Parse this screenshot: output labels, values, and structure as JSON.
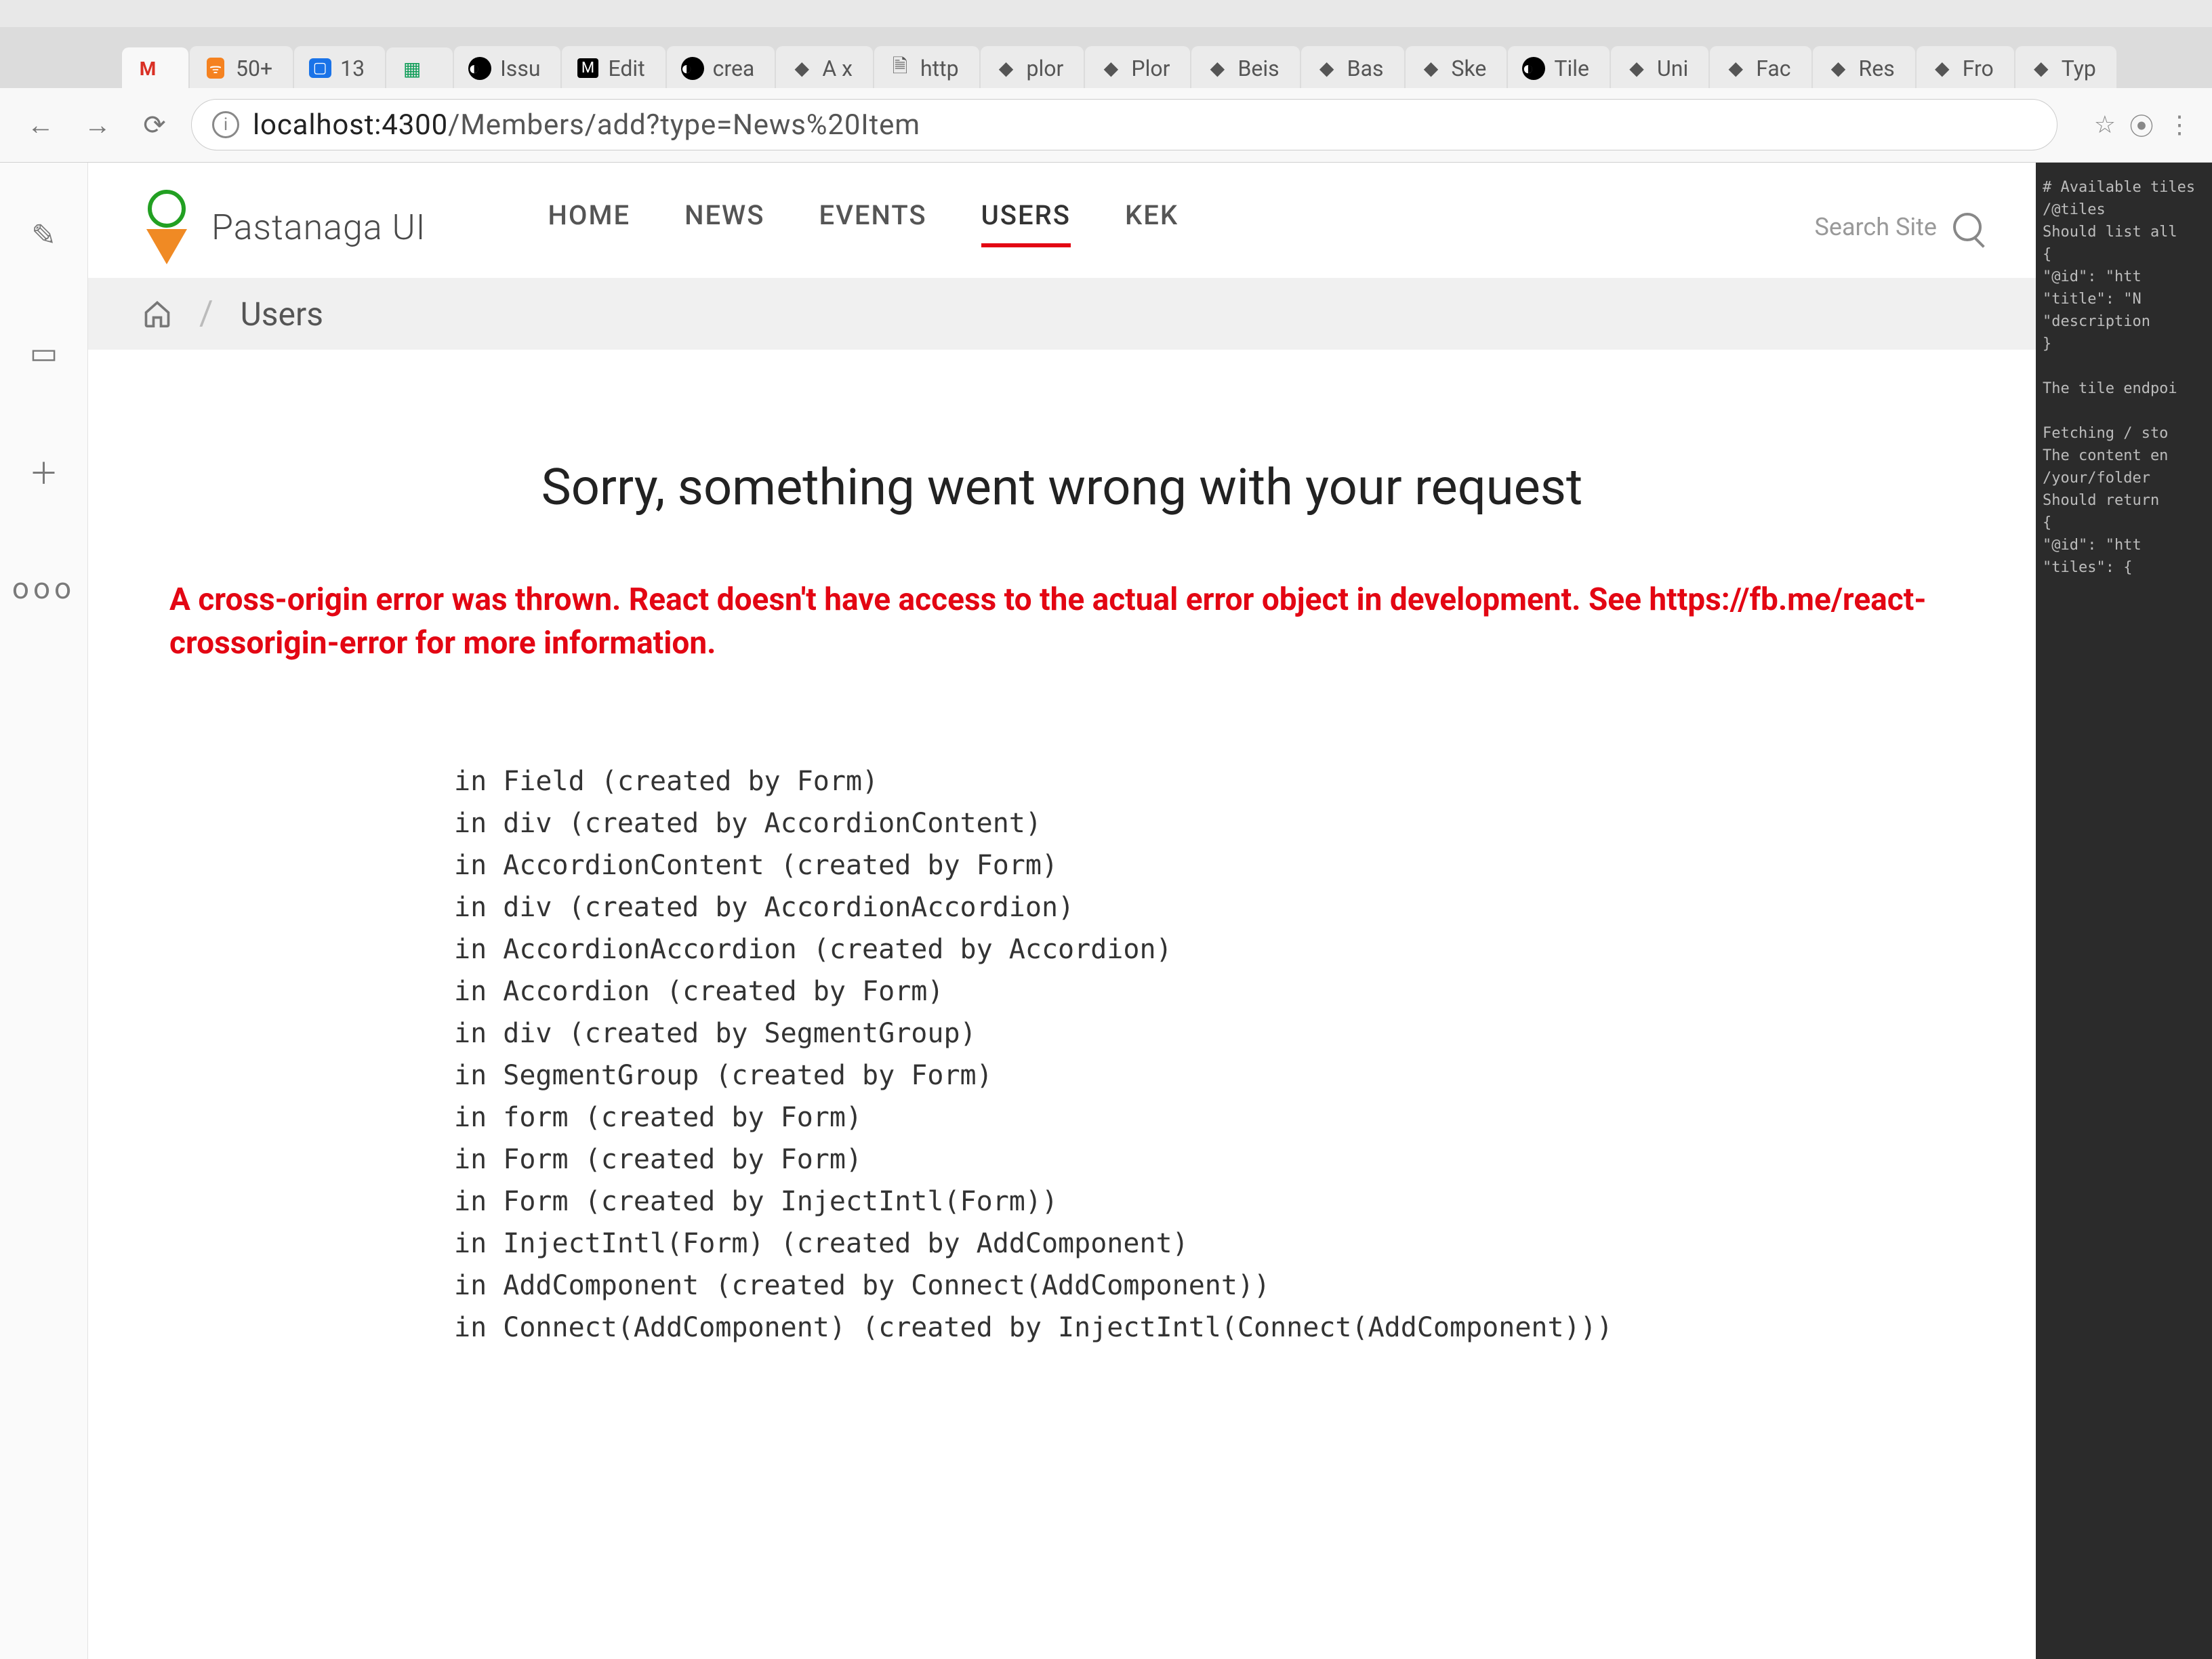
{
  "browser": {
    "tabs": [
      {
        "favicon": "gmail",
        "label": ""
      },
      {
        "favicon": "rss",
        "label": "50+"
      },
      {
        "favicon": "cal",
        "label": "13"
      },
      {
        "favicon": "sheets",
        "label": ""
      },
      {
        "favicon": "gh",
        "label": "Issu"
      },
      {
        "favicon": "m",
        "label": "Edit"
      },
      {
        "favicon": "gh",
        "label": "crea"
      },
      {
        "favicon": "",
        "label": "A x"
      },
      {
        "favicon": "doc",
        "label": "http"
      },
      {
        "favicon": "",
        "label": "plor"
      },
      {
        "favicon": "",
        "label": "Plor"
      },
      {
        "favicon": "",
        "label": "Beis"
      },
      {
        "favicon": "",
        "label": "Bas"
      },
      {
        "favicon": "",
        "label": "Ske"
      },
      {
        "favicon": "gh",
        "label": "Tile"
      },
      {
        "favicon": "",
        "label": "Uni"
      },
      {
        "favicon": "",
        "label": "Fac"
      },
      {
        "favicon": "",
        "label": "Res"
      },
      {
        "favicon": "",
        "label": "Fro"
      },
      {
        "favicon": "",
        "label": "Typ"
      }
    ],
    "url_host": "localhost:4300",
    "url_path": "/Members/add?type=News%20Item"
  },
  "site": {
    "brand": "Pastanaga UI",
    "nav": [
      "HOME",
      "NEWS",
      "EVENTS",
      "USERS",
      "KEK"
    ],
    "nav_active_index": 3,
    "search_placeholder": "Search Site",
    "breadcrumb_current": "Users"
  },
  "error": {
    "title": "Sorry, something went wrong with your request",
    "message": "A cross-origin error was thrown. React doesn't have access to the actual error object in development. See https://fb.me/react-crossorigin-error for more information.",
    "stack": [
      "in Field (created by Form)",
      "in div (created by AccordionContent)",
      "in AccordionContent (created by Form)",
      "in div (created by AccordionAccordion)",
      "in AccordionAccordion (created by Accordion)",
      "in Accordion (created by Form)",
      "in div (created by SegmentGroup)",
      "in SegmentGroup (created by Form)",
      "in form (created by Form)",
      "in Form (created by Form)",
      "in Form (created by InjectIntl(Form))",
      "in InjectIntl(Form) (created by AddComponent)",
      "in AddComponent (created by Connect(AddComponent))",
      "in Connect(AddComponent) (created by InjectIntl(Connect(AddComponent)))"
    ]
  },
  "editor_side_lines": [
    "# Available tiles",
    "/@tiles",
    "Should list all",
    "{",
    "  \"@id\": \"htt",
    "  \"title\": \"N",
    "  \"description",
    "}",
    "",
    "The tile endpoi",
    "",
    "Fetching / sto",
    "The content en",
    "/your/folder",
    "Should return",
    "{",
    "  \"@id\": \"htt",
    "  \"tiles\": {"
  ]
}
